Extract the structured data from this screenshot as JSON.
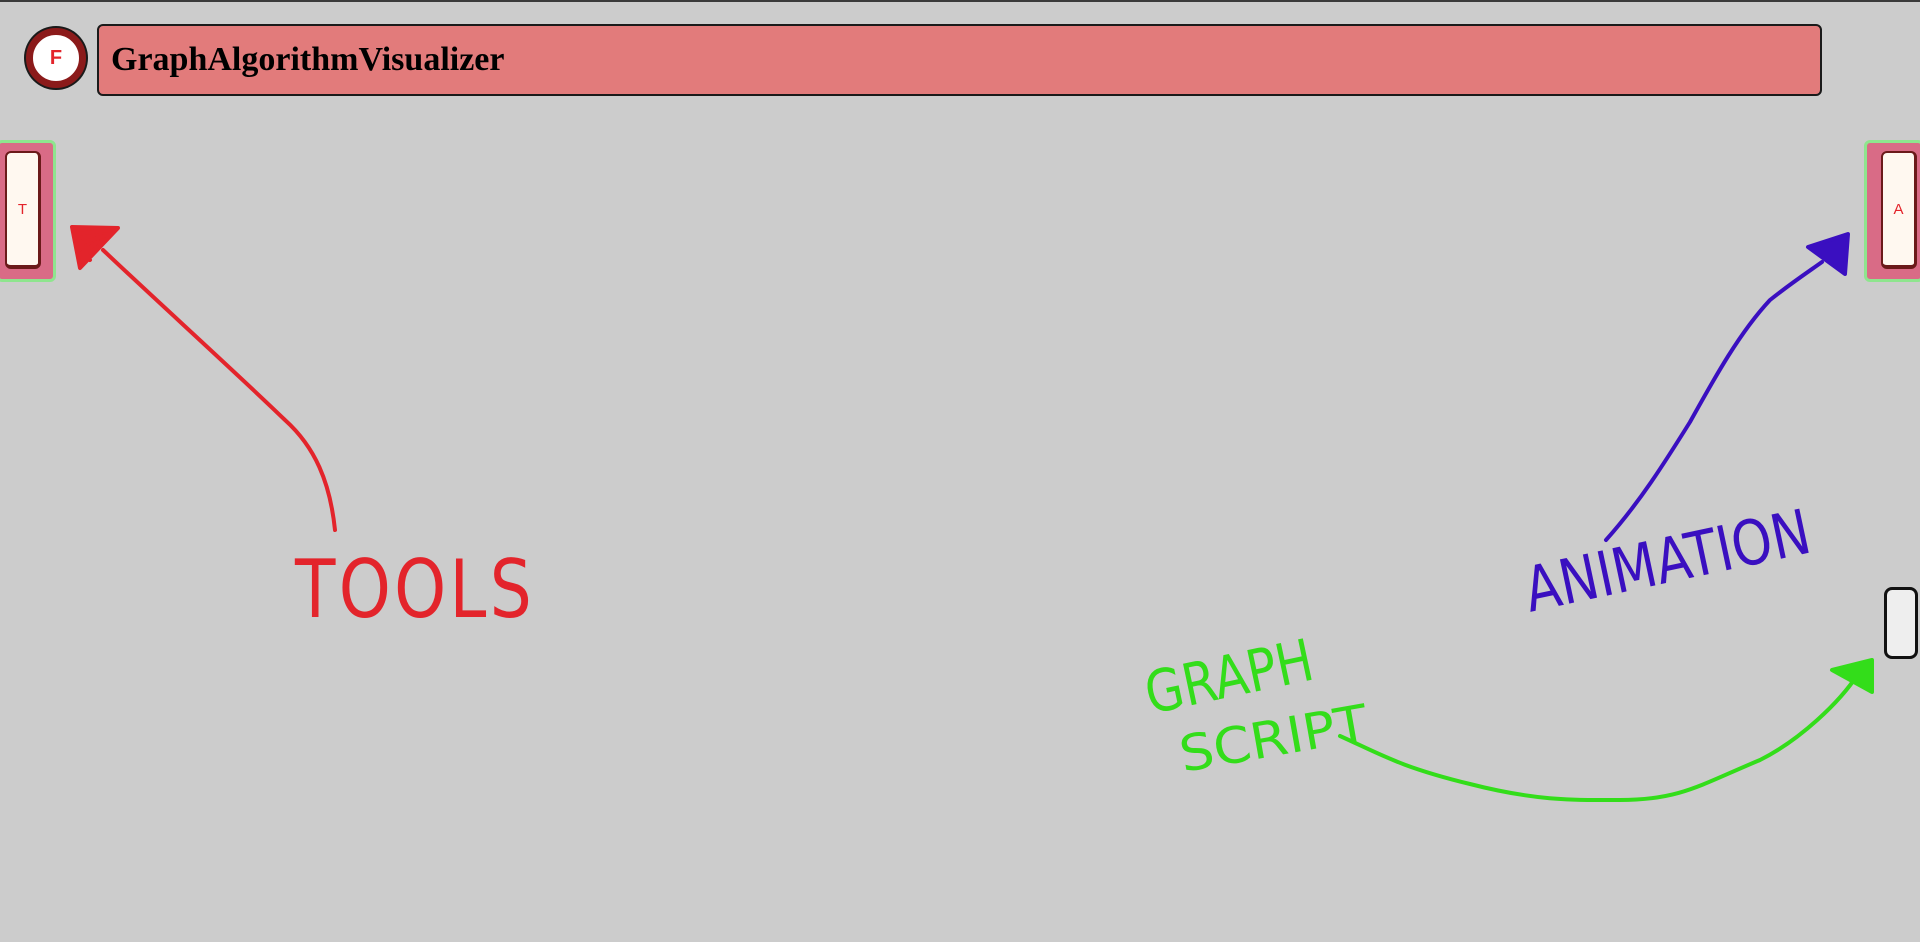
{
  "app": {
    "logo_letter": "F",
    "title": "GraphAlgorithmVisualizer"
  },
  "panels": {
    "tools_tab_letter": "T",
    "animation_tab_letter": "A"
  },
  "annotations": {
    "tools_label": "TOOLS",
    "animation_label": "ANIMATION",
    "graph_script_label_line1": "GRAPH",
    "graph_script_label_line2": "SCRIPT"
  },
  "colors": {
    "background": "#cccccc",
    "title_bar": "#e27b7b",
    "side_tab": "#d96b86",
    "side_tab_border": "#8ee58e",
    "tools_annotation": "#e3242b",
    "animation_annotation": "#3a0fc0",
    "graph_script_annotation": "#33dd1a"
  }
}
